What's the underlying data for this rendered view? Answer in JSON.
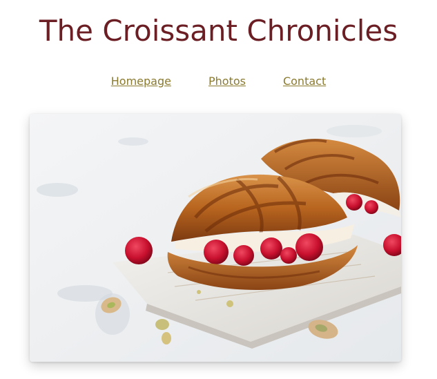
{
  "header": {
    "title": "The Croissant Chronicles"
  },
  "nav": {
    "items": [
      {
        "label": "Homepage"
      },
      {
        "label": "Photos"
      },
      {
        "label": "Contact"
      }
    ]
  },
  "hero": {
    "subject": "croissant-with-raspberries-photo"
  },
  "colors": {
    "title": "#6b1f24",
    "link": "#8a7a2e"
  }
}
